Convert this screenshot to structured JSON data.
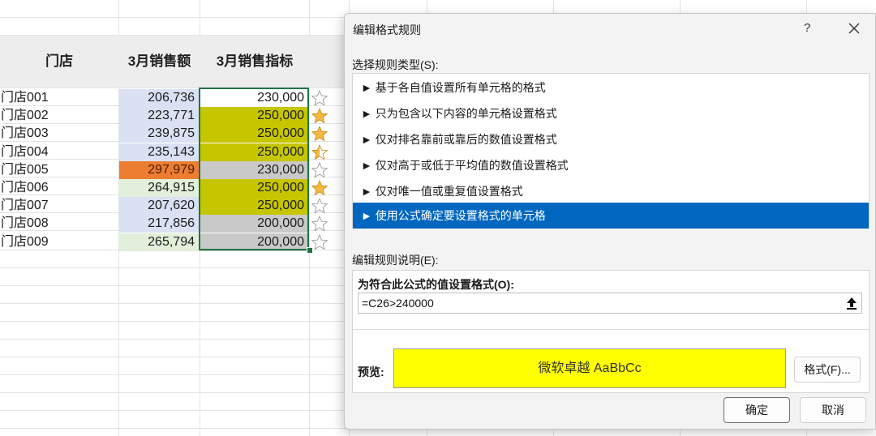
{
  "sheet": {
    "headers": [
      "门店",
      "3月销售额",
      "3月销售指标"
    ],
    "rows": [
      {
        "name": "门店001",
        "sales": "206,736",
        "target": "230,000",
        "salesBg": "#d9e1f2",
        "targetBg": "#ffffff",
        "star": "empty",
        "salesColor": "#1b1b1b"
      },
      {
        "name": "门店002",
        "sales": "223,771",
        "target": "250,000",
        "salesBg": "#d9e1f2",
        "targetBg": "#c6c600",
        "star": "filled",
        "salesColor": "#1b1b1b"
      },
      {
        "name": "门店003",
        "sales": "239,875",
        "target": "250,000",
        "salesBg": "#d9e1f2",
        "targetBg": "#c6c600",
        "star": "filled",
        "salesColor": "#1b1b1b"
      },
      {
        "name": "门店004",
        "sales": "235,143",
        "target": "250,000",
        "salesBg": "#d9e1f2",
        "targetBg": "#c6c600",
        "star": "half",
        "salesColor": "#1b1b1b"
      },
      {
        "name": "门店005",
        "sales": "297,979",
        "target": "230,000",
        "salesBg": "#ed7d31",
        "targetBg": "#c9c9c9",
        "star": "empty",
        "salesColor": "#4a1d00"
      },
      {
        "name": "门店006",
        "sales": "264,915",
        "target": "250,000",
        "salesBg": "#e2efda",
        "targetBg": "#c6c600",
        "star": "filled",
        "salesColor": "#1b1b1b"
      },
      {
        "name": "门店007",
        "sales": "207,620",
        "target": "250,000",
        "salesBg": "#d9e1f2",
        "targetBg": "#c6c600",
        "star": "empty",
        "salesColor": "#1b1b1b"
      },
      {
        "name": "门店008",
        "sales": "217,856",
        "target": "200,000",
        "salesBg": "#d9e1f2",
        "targetBg": "#c9c9c9",
        "star": "empty",
        "salesColor": "#1b1b1b"
      },
      {
        "name": "门店009",
        "sales": "265,794",
        "target": "200,000",
        "salesBg": "#e2efda",
        "targetBg": "#c9c9c9",
        "star": "empty",
        "salesColor": "#1b1b1b"
      }
    ]
  },
  "dialog": {
    "title": "编辑格式规则",
    "help": "?",
    "close_icon": "close-icon",
    "rule_type_label": "选择规则类型(S):",
    "rule_types": [
      "► 基于各自值设置所有单元格的格式",
      "► 只为包含以下内容的单元格设置格式",
      "► 仅对排名靠前或靠后的数值设置格式",
      "► 仅对高于或低于平均值的数值设置格式",
      "► 仅对唯一值或重复值设置格式",
      "► 使用公式确定要设置格式的单元格"
    ],
    "selected_rule_index": 5,
    "desc_label": "编辑规则说明(E):",
    "formula_label": "为符合此公式的值设置格式(O):",
    "formula_value": "=C26>240000",
    "preview_label": "预览:",
    "preview_text": "微软卓越  AaBbCc",
    "preview_bg": "#ffff00",
    "format_button": "格式(F)...",
    "ok_button": "确定",
    "cancel_button": "取消",
    "selection_color": "#0067c0"
  }
}
